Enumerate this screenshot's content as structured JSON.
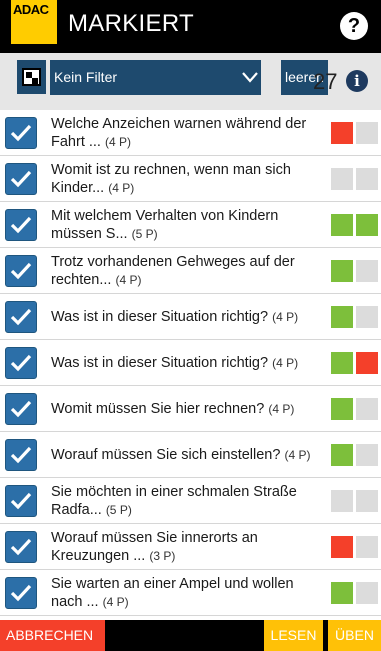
{
  "header": {
    "logo_text": "ADAC",
    "title": "MARKIERT",
    "help_symbol": "?"
  },
  "toolbar": {
    "filter_label": "Kein Filter",
    "clear_label": "leeren",
    "count": "27",
    "info_symbol": "i"
  },
  "questions": [
    {
      "line1": "Welche Anzeichen warnen während der",
      "line2": "Fahrt ...",
      "points": "(4 P)",
      "status": [
        "red",
        "grey"
      ]
    },
    {
      "line1": "Womit ist zu rechnen, wenn man sich",
      "line2": "Kinder...",
      "points": "(4 P)",
      "status": [
        "grey",
        "grey"
      ]
    },
    {
      "line1": "Mit welchem Verhalten von Kindern",
      "line2": "müssen S...",
      "points": "(5 P)",
      "status": [
        "green",
        "green"
      ]
    },
    {
      "line1": "Trotz vorhandenen Gehweges auf der",
      "line2": "rechten...",
      "points": "(4 P)",
      "status": [
        "green",
        "grey"
      ]
    },
    {
      "line1": "Was ist in dieser Situation richtig?",
      "line2": "",
      "points": "(4 P)",
      "status": [
        "green",
        "grey"
      ]
    },
    {
      "line1": "Was ist in dieser Situation richtig?",
      "line2": "",
      "points": "(4 P)",
      "status": [
        "green",
        "red"
      ]
    },
    {
      "line1": "Womit müssen Sie hier rechnen?",
      "line2": "",
      "points": "(4 P)",
      "status": [
        "green",
        "grey"
      ]
    },
    {
      "line1": "Worauf müssen Sie sich einstellen?",
      "line2": "",
      "points": "(4 P)",
      "status": [
        "green",
        "grey"
      ]
    },
    {
      "line1": "Sie möchten in einer schmalen Straße",
      "line2": "Radfa...",
      "points": "(5 P)",
      "status": [
        "grey",
        "grey"
      ]
    },
    {
      "line1": "Worauf müssen Sie innerorts an",
      "line2": "Kreuzungen ...",
      "points": "(3 P)",
      "status": [
        "red",
        "grey"
      ]
    },
    {
      "line1": "Sie warten an einer Ampel und wollen",
      "line2": "nach ...",
      "points": "(4 P)",
      "status": [
        "green",
        "grey"
      ]
    }
  ],
  "footer": {
    "cancel_label": "ABBRECHEN",
    "read_label": "LESEN",
    "practice_label": "ÜBEN"
  },
  "colors": {
    "red": "#f4402a",
    "green": "#7dbf3b",
    "grey": "#dcdcdc",
    "accent": "#1e4a6e",
    "logo_yellow": "#ffcc00",
    "button_yellow": "#ffc107"
  }
}
